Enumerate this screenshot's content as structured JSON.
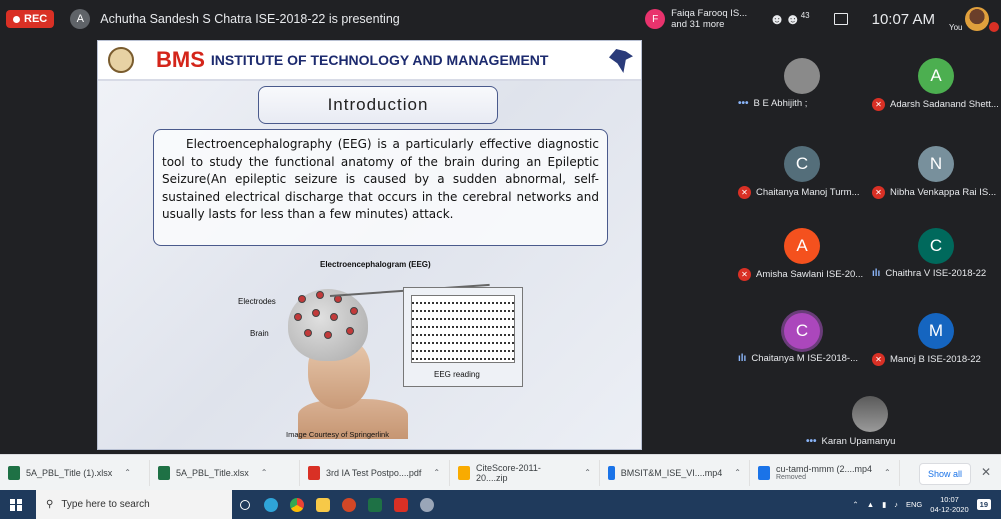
{
  "meet": {
    "rec_label": "REC",
    "presenter_initial": "A",
    "presenter_text": "Achutha Sandesh S Chatra ISE-2018-22 is presenting",
    "raised_initial": "F",
    "raised_text_1": "Faiqa Farooq IS...",
    "raised_text_2": "and 31 more",
    "people_icon": "people-icon",
    "people_count": "43",
    "time": "10:07 AM",
    "you_label": "You"
  },
  "slide": {
    "brand": "BMS",
    "institute": "INSTITUTE OF TECHNOLOGY AND MANAGEMENT",
    "title": "Introduction",
    "body": "Electroencephalography (EEG) is a particularly effective diagnostic tool to study the functional anatomy of the brain during an Epileptic Seizure(An epileptic seizure is caused by a sudden abnormal, self-sustained electrical discharge that occurs in the cerebral networks and usually lasts for less than a few minutes) attack.",
    "figure_title": "Electroencephalogram (EEG)",
    "label_electrodes": "Electrodes",
    "label_brain": "Brain",
    "label_eeg_reading": "EEG reading",
    "courtesy": "Image Courtesy of Springerlink"
  },
  "participants": [
    {
      "initial": "",
      "name": "B E Abhijith ;",
      "status": "speaking",
      "color": "#7c7c7c"
    },
    {
      "initial": "A",
      "name": "Adarsh Sadanand Shett...",
      "status": "muted",
      "color": "#4caf50"
    },
    {
      "initial": "C",
      "name": "Chaitanya Manoj Turm...",
      "status": "muted",
      "color": "#546e7a"
    },
    {
      "initial": "N",
      "name": "Nibha Venkappa Rai IS...",
      "status": "muted",
      "color": "#78909c"
    },
    {
      "initial": "A",
      "name": "Amisha Sawlani ISE-20...",
      "status": "muted",
      "color": "#f4511e"
    },
    {
      "initial": "C",
      "name": "Chaithra V ISE-2018-22",
      "status": "talking",
      "color": "#00695c"
    },
    {
      "initial": "C",
      "name": "Chaitanya M ISE-2018-...",
      "status": "talking",
      "color": "#ab47bc"
    },
    {
      "initial": "M",
      "name": "Manoj B ISE-2018-22",
      "status": "muted",
      "color": "#1565c0"
    },
    {
      "initial": "",
      "name": "Karan Upamanyu",
      "status": "speaking",
      "color": "#6d6d6d"
    }
  ],
  "downloads": [
    {
      "name": "5A_PBL_Title (1).xlsx",
      "color": "#1e7145"
    },
    {
      "name": "5A_PBL_Title.xlsx",
      "color": "#1e7145"
    },
    {
      "name": "3rd IA Test Postpo....pdf",
      "color": "#d93025"
    },
    {
      "name": "CiteScore-2011-20....zip",
      "color": "#f9ab00"
    },
    {
      "name": "BMSIT&M_ISE_VI....mp4",
      "color": "#1a73e8"
    },
    {
      "name": "cu-tamd-mmm (2....mp4",
      "sub": "Removed",
      "color": "#1a73e8"
    }
  ],
  "downloads_show_all": "Show all",
  "taskbar": {
    "search_placeholder": "Type here to search",
    "lang": "ENG",
    "clock_time": "10:07",
    "clock_date": "04-12-2020",
    "notif_count": "19"
  }
}
